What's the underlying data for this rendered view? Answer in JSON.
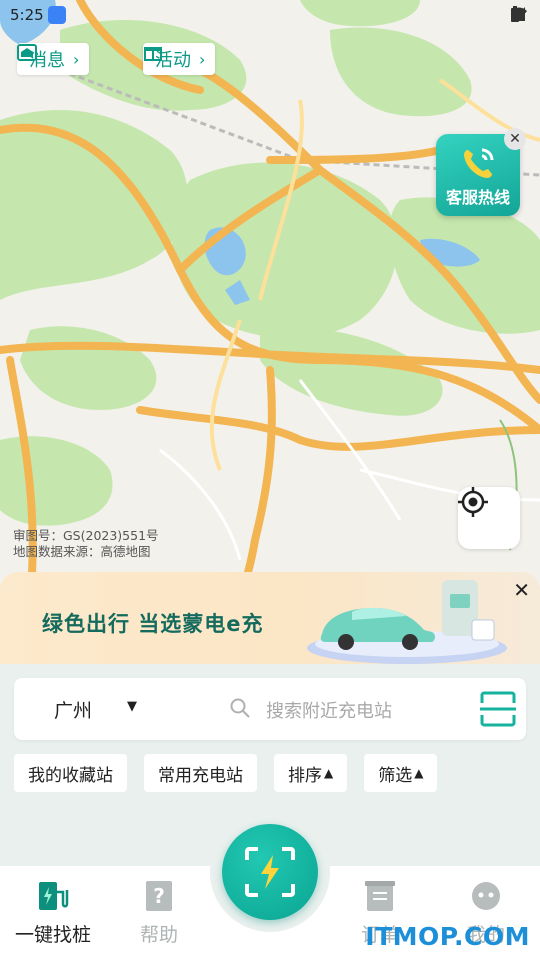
{
  "status_bar": {
    "time": "5:25"
  },
  "map": {
    "message_chip": "消息",
    "activity_chip": "活动",
    "hotline_label": "客服热线",
    "attribution_line1": "审图号：GS(2023)551号",
    "attribution_line2": "地图数据来源：高德地图"
  },
  "banner": {
    "slogan": "绿色出行 当选蒙电e充"
  },
  "search": {
    "city": "广州",
    "placeholder": "搜索附近充电站"
  },
  "filters": [
    {
      "label": "我的收藏站"
    },
    {
      "label": "常用充电站"
    },
    {
      "label": "排序"
    },
    {
      "label": "筛选"
    }
  ],
  "nav": {
    "items": [
      {
        "label": "一键找桩",
        "icon": "charging-pile-icon",
        "active": true
      },
      {
        "label": "帮助",
        "icon": "help-icon",
        "active": false
      },
      {
        "label": "订单",
        "icon": "order-icon",
        "active": false
      },
      {
        "label": "我的",
        "icon": "profile-icon",
        "active": false
      }
    ]
  },
  "colors": {
    "accent": "#0fa895",
    "road": "#f3b552",
    "green": "#bfe3a7",
    "water": "#86c1ee"
  },
  "watermark": "ITMOP.COM"
}
